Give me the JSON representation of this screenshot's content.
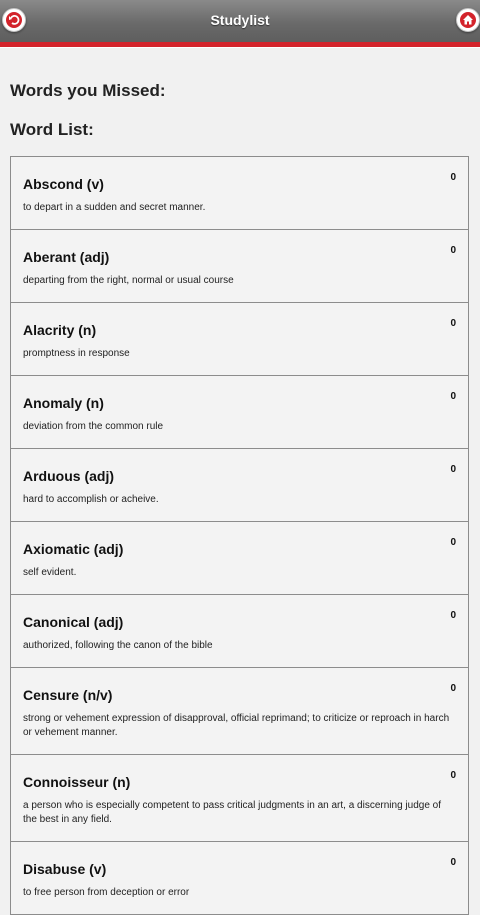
{
  "header": {
    "title": "Studylist"
  },
  "sections": {
    "missed": "Words you Missed:",
    "list": "Word List:"
  },
  "words": [
    {
      "title": "Abscond (v)",
      "definition": "to depart in a sudden and secret manner.",
      "count": "0"
    },
    {
      "title": "Aberant (adj)",
      "definition": "departing from the right, normal or usual course",
      "count": "0"
    },
    {
      "title": "Alacrity (n)",
      "definition": "promptness in response",
      "count": "0"
    },
    {
      "title": "Anomaly (n)",
      "definition": "deviation from the common rule",
      "count": "0"
    },
    {
      "title": "Arduous (adj)",
      "definition": "hard to accomplish or acheive.",
      "count": "0"
    },
    {
      "title": "Axiomatic (adj)",
      "definition": "self evident.",
      "count": "0"
    },
    {
      "title": "Canonical (adj)",
      "definition": "authorized, following the canon of the bible",
      "count": "0"
    },
    {
      "title": "Censure (n/v)",
      "definition": "strong or vehement expression of disapproval, official reprimand; to criticize or reproach in harch or vehement manner.",
      "count": "0"
    },
    {
      "title": "Connoisseur (n)",
      "definition": "a person who is especially competent to pass critical judgments in an art, a discerning judge of the best in any field.",
      "count": "0"
    },
    {
      "title": "Disabuse (v)",
      "definition": "to free person from deception or error",
      "count": "0"
    }
  ],
  "icons": {
    "back": "back-arrow-icon",
    "home": "home-icon"
  },
  "colors": {
    "accent": "#d3232b",
    "header": "#6f6f6f",
    "background": "#f1f1f1"
  }
}
